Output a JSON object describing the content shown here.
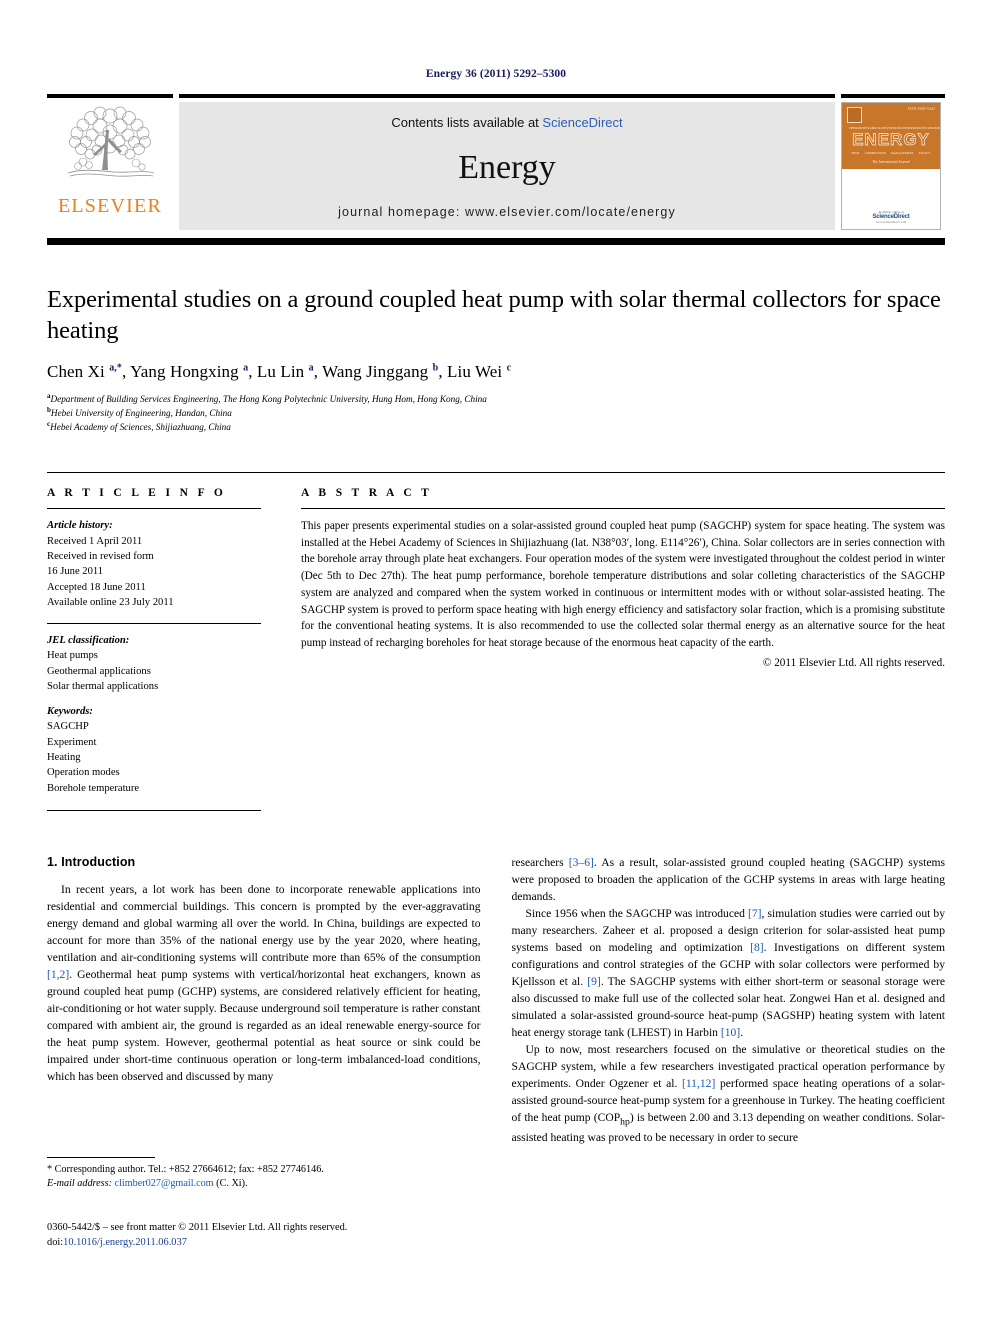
{
  "running_head": "Energy 36 (2011) 5292–5300",
  "masthead": {
    "publisher_logo_text": "ELSEVIER",
    "contents_prefix": "Contents lists available at",
    "contents_link": "ScienceDirect",
    "journal_name": "Energy",
    "homepage": "journal homepage: www.elsevier.com/locate/energy",
    "cover": {
      "title": "ENERGY",
      "subtitle": "The International Journal",
      "issn": "ISSN 0360-5442",
      "keywords": [
        "THERMODYNAMICS",
        "CONVERSION",
        "CONSERVATION",
        "ECONOMICS",
        "HEAT",
        "COMBUSTION",
        "MANAGEMENT",
        "POLICY"
      ],
      "available_online": "Available online at",
      "sciencedirect": "ScienceDirect",
      "url": "www.sciencedirect.com"
    }
  },
  "article": {
    "title": "Experimental studies on a ground coupled heat pump with solar thermal collectors for space heating",
    "authors_html": "Chen Xi <sup>a,*</sup>, Yang Hongxing <sup>a</sup>, Lu Lin <sup>a</sup>, Wang Jinggang <sup>b</sup>, Liu Wei <sup>c</sup>",
    "affiliations": [
      "Department of Building Services Engineering, The Hong Kong Polytechnic University, Hung Hom, Hong Kong, China",
      "Hebei University of Engineering, Handan, China",
      "Hebei Academy of Sciences, Shijiazhuang, China"
    ],
    "affiliation_marks": [
      "a",
      "b",
      "c"
    ]
  },
  "article_info": {
    "heading": "A R T I C L E  I N F O",
    "history_label": "Article history:",
    "history": [
      "Received 1 April 2011",
      "Received in revised form",
      "16 June 2011",
      "Accepted 18 June 2011",
      "Available online 23 July 2011"
    ],
    "jel_label": "JEL classification:",
    "jel": [
      "Heat pumps",
      "Geothermal applications",
      "Solar thermal applications"
    ],
    "keywords_label": "Keywords:",
    "keywords": [
      "SAGCHP",
      "Experiment",
      "Heating",
      "Operation modes",
      "Borehole temperature"
    ]
  },
  "abstract": {
    "heading": "A B S T R A C T",
    "text": "This paper presents experimental studies on a solar-assisted ground coupled heat pump (SAGCHP) system for space heating. The system was installed at the Hebei Academy of Sciences in Shijiazhuang (lat. N38°03′, long. E114°26′), China. Solar collectors are in series connection with the borehole array through plate heat exchangers. Four operation modes of the system were investigated throughout the coldest period in winter (Dec 5th to Dec 27th). The heat pump performance, borehole temperature distributions and solar colleting characteristics of the SAGCHP system are analyzed and compared when the system worked in continuous or intermittent modes with or without solar-assisted heating. The SAGCHP system is proved to perform space heating with high energy efficiency and satisfactory solar fraction, which is a promising substitute for the conventional heating systems. It is also recommended to use the collected solar thermal energy as an alternative source for the heat pump instead of recharging boreholes for heat storage because of the enormous heat capacity of the earth.",
    "copyright": "© 2011 Elsevier Ltd. All rights reserved."
  },
  "introduction": {
    "heading": "1. Introduction",
    "left_paragraph_1": "In recent years, a lot work has been done to incorporate renewable applications into residential and commercial buildings. This concern is prompted by the ever-aggravating energy demand and global warming all over the world. In China, buildings are expected to account for more than 35% of the national energy use by the year 2020, where heating, ventilation and air-conditioning systems will contribute more than 65% of the consumption ",
    "left_ref_1": "[1,2]",
    "left_paragraph_1b": ". Geothermal heat pump systems with vertical/horizontal heat exchangers, known as ground coupled heat pump (GCHP) systems, are considered relatively efficient for heating, air-conditioning or hot water supply. Because underground soil temperature is rather constant compared with ambient air, the ground is regarded as an ideal renewable energy-source for the heat pump system. However, geothermal potential as heat source or sink could be impaired under short-time continuous operation or long-term imbalanced-load conditions, which has been observed and discussed by many",
    "right_p1_a": "researchers ",
    "right_p1_ref": "[3–6]",
    "right_p1_b": ". As a result, solar-assisted ground coupled heating (SAGCHP) systems were proposed to broaden the application of the GCHP systems in areas with large heating demands.",
    "right_p2_a": "Since 1956 when the SAGCHP was introduced ",
    "right_p2_ref1": "[7]",
    "right_p2_b": ", simulation studies were carried out by many researchers. Zaheer et al. proposed a design criterion for solar-assisted heat pump systems based on modeling and optimization ",
    "right_p2_ref2": "[8]",
    "right_p2_c": ". Investigations on different system configurations and control strategies of the GCHP with solar collectors were performed by Kjellsson et al. ",
    "right_p2_ref3": "[9]",
    "right_p2_d": ". The SAGCHP systems with either short-term or seasonal storage were also discussed to make full use of the collected solar heat. Zongwei Han et al. designed and simulated a solar-assisted ground-source heat-pump (SAGSHP) heating system with latent heat energy storage tank (LHEST) in Harbin ",
    "right_p2_ref4": "[10]",
    "right_p2_e": ".",
    "right_p3_a": "Up to now, most researchers focused on the simulative or theoretical studies on the SAGCHP system, while a few researchers investigated practical operation performance by experiments. Onder Ogzener et al. ",
    "right_p3_ref": "[11,12]",
    "right_p3_b": " performed space heating operations of a solar-assisted ground-source heat-pump system for a greenhouse in Turkey. The heating coefficient of the heat pump (COP",
    "right_p3_sub": "hp",
    "right_p3_c": ") is between 2.00 and 3.13 depending on weather conditions. Solar-assisted heating was proved to be necessary in order to secure"
  },
  "footnote": {
    "corresponding": "* Corresponding author. Tel.: +852 27664612; fax: +852 27746146.",
    "email_label": "E-mail address:",
    "email": "climber027@gmail.com",
    "email_owner": "(C. Xi)."
  },
  "imprint": {
    "line1": "0360-5442/$ – see front matter © 2011 Elsevier Ltd. All rights reserved.",
    "doi_label": "doi:",
    "doi": "10.1016/j.energy.2011.06.037"
  },
  "colors": {
    "running_head": "#1a1a5e",
    "elsevier_orange": "#ef7d1a",
    "link_blue": "#2b5eb5",
    "ref_blue": "#1a5ab5",
    "panel_gray": "#e6e6e6",
    "cover_orange": "#c8762a"
  }
}
